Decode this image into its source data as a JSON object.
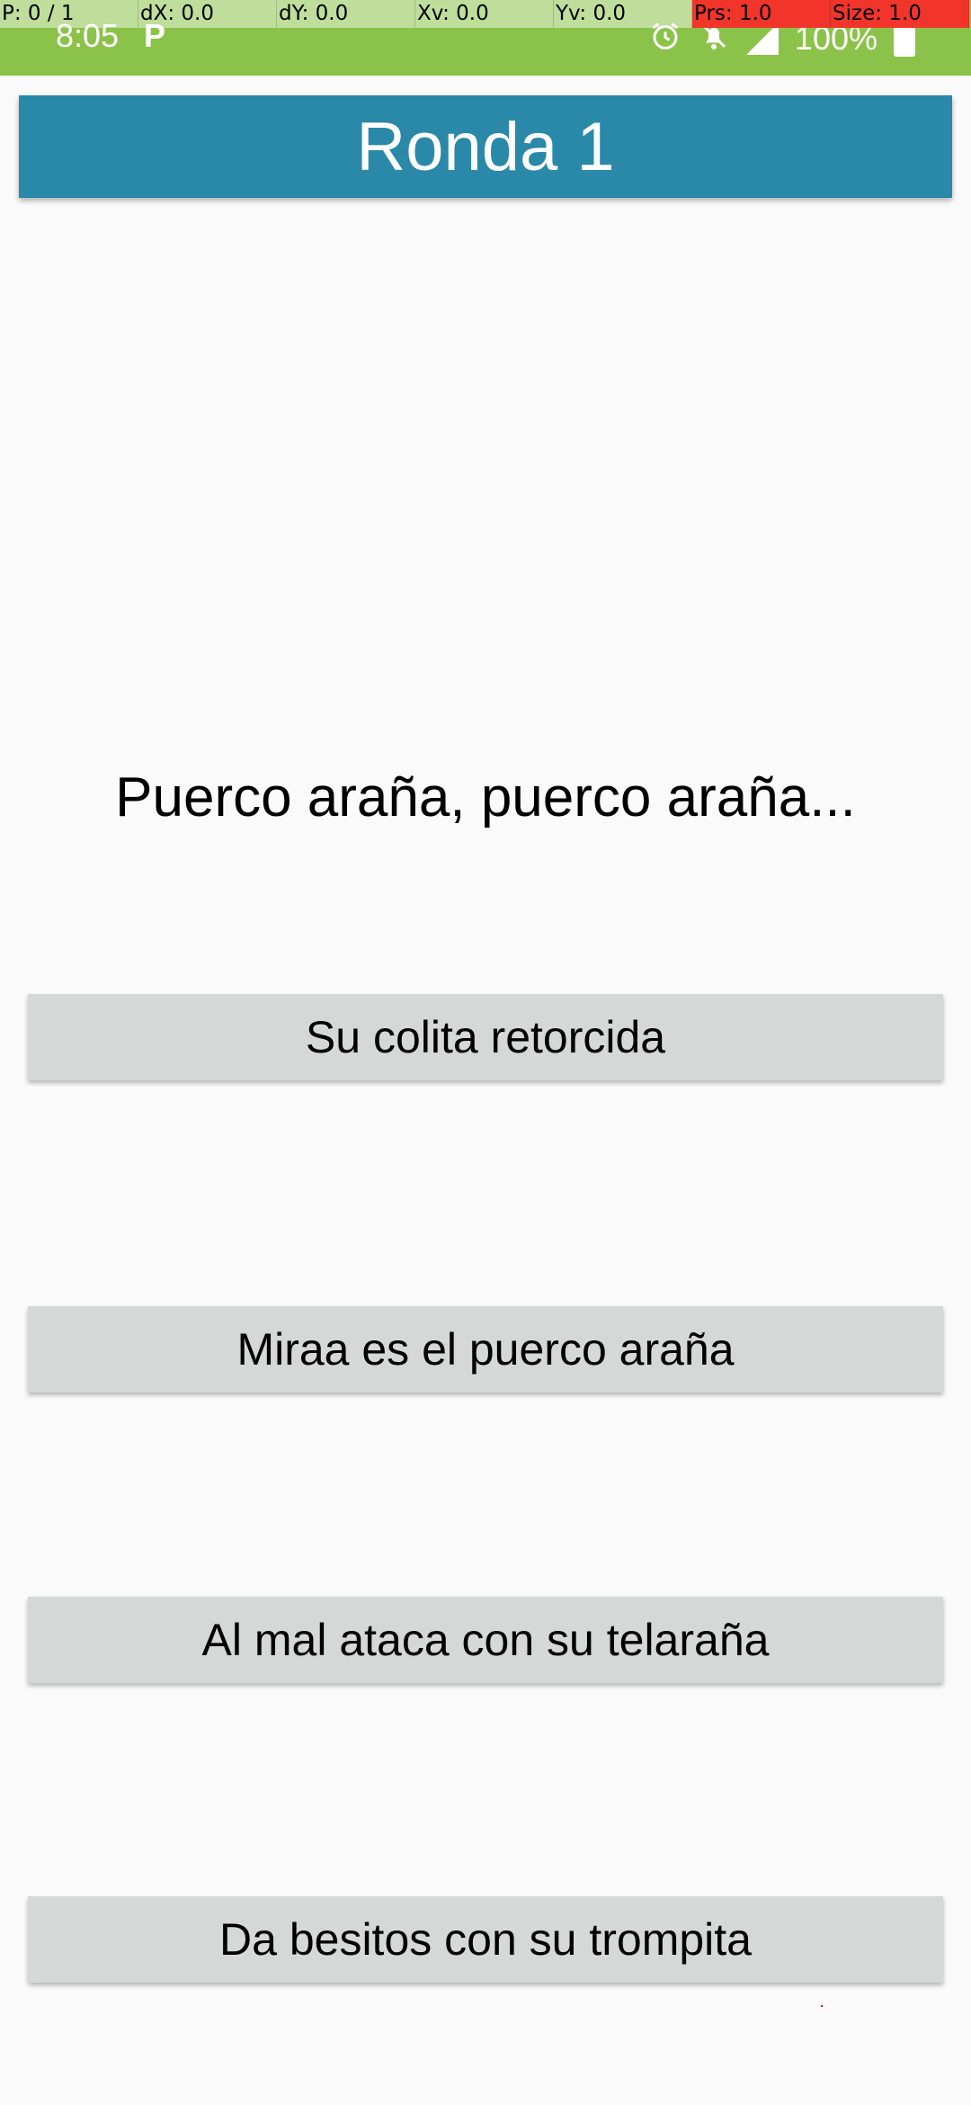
{
  "status_bar": {
    "time": "8:05",
    "app_icon": "P",
    "battery_text": "100%",
    "background_color": "#8bc34a",
    "icons": [
      "alarm-icon",
      "bell-off-icon",
      "signal-icon",
      "battery-icon"
    ]
  },
  "debug_overlay": {
    "pointer": "P: 0 / 1",
    "dx": "dX: 0.0",
    "dy": "dY: 0.0",
    "xv": "Xv: 0.0",
    "yv": "Yv: 0.0",
    "prs": "Prs: 1.0",
    "size": "Size: 1.0"
  },
  "header": {
    "title": "Ronda 1",
    "background_color": "#2a88a8"
  },
  "question": {
    "text": "Puerco araña, puerco araña..."
  },
  "answers": [
    {
      "label": "Su colita retorcida"
    },
    {
      "label": "Miraa es el puerco araña"
    },
    {
      "label": "Al mal ataca con su telaraña"
    },
    {
      "label": "Da besitos con su trompita"
    }
  ]
}
